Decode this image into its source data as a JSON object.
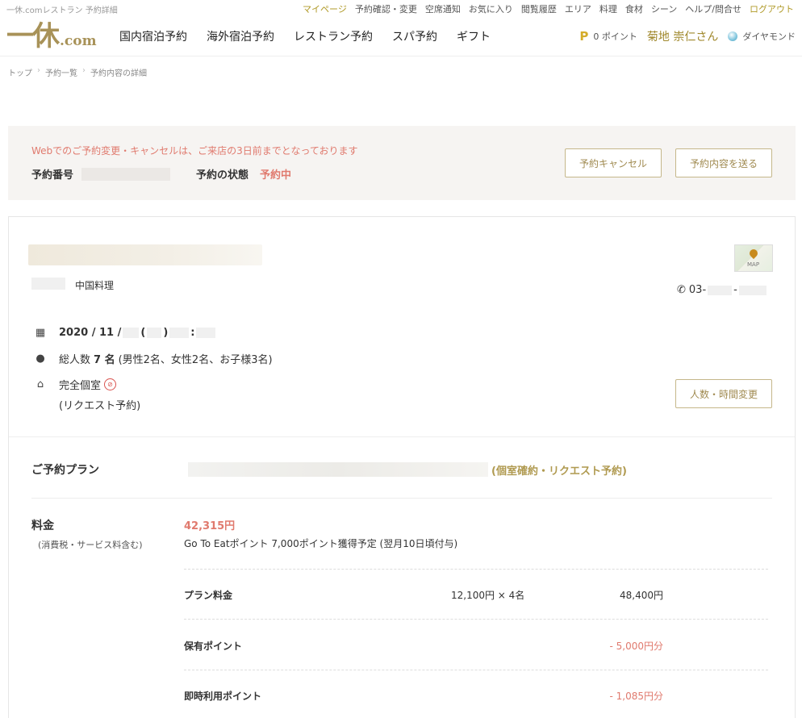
{
  "util_bar": {
    "site_name": "一休.comレストラン 予約詳細",
    "links": [
      {
        "label": "マイページ",
        "highlight": true
      },
      {
        "label": "予約確認・変更",
        "highlight": false
      },
      {
        "label": "空席通知",
        "highlight": false
      },
      {
        "label": "お気に入り",
        "highlight": false
      },
      {
        "label": "閲覧履歴",
        "highlight": false
      },
      {
        "label": "エリア",
        "highlight": false
      },
      {
        "label": "料理",
        "highlight": false
      },
      {
        "label": "食材",
        "highlight": false
      },
      {
        "label": "シーン",
        "highlight": false
      },
      {
        "label": "ヘルプ/問合せ",
        "highlight": false
      },
      {
        "label": "ログアウト",
        "highlight": true
      }
    ]
  },
  "header": {
    "logo_main": "一休",
    "logo_suffix": ".com",
    "nav": [
      "国内宿泊予約",
      "海外宿泊予約",
      "レストラン予約",
      "スパ予約",
      "ギフト"
    ],
    "points_icon": "P",
    "points": "0 ポイント",
    "user_name": "菊地 崇仁さん",
    "rank": "ダイヤモンド"
  },
  "breadcrumb": [
    "トップ",
    "予約一覧",
    "予約内容の詳細"
  ],
  "notice": {
    "message": "Webでのご予約変更・キャンセルは、ご来店の3日前までとなっております",
    "reservation_number_label": "予約番号",
    "status_label": "予約の状態",
    "status_value": "予約中",
    "cancel_button": "予約キャンセル",
    "send_button": "予約内容を送る"
  },
  "restaurant": {
    "cuisine": "中国料理",
    "map_label": "MAP",
    "phone_prefix": "03-",
    "phone_sep": "-",
    "date_prefix": "2020 / 11 /",
    "date_paren_open": "(",
    "date_paren_close": ")",
    "date_colon": ":",
    "people_prefix": "総人数",
    "people_count": "7 名",
    "people_detail": "(男性2名、女性2名、お子様3名)",
    "room": "完全個室",
    "room_note": "(リクエスト予約)",
    "change_button": "人数・時間変更"
  },
  "plan": {
    "label": "ご予約プラン",
    "type": "(個室確約・リクエスト予約)"
  },
  "price": {
    "label": "料金",
    "note": "(消費税・サービス料含む)",
    "total": "42,315円",
    "goto_eat": "Go To Eatポイント 7,000ポイント獲得予定 (翌月10日頃付与)",
    "rows": [
      {
        "label": "プラン料金",
        "calc": "12,100円 × 4名",
        "amount": "48,400円"
      },
      {
        "label": "保有ポイント",
        "calc": "",
        "amount": "- 5,000円分"
      },
      {
        "label": "即時利用ポイント",
        "calc": "",
        "amount": "- 1,085円分"
      }
    ]
  },
  "colors": {
    "gold": "#b09a28",
    "accent_red": "#e07a6e",
    "button_border": "#c5b78a"
  }
}
